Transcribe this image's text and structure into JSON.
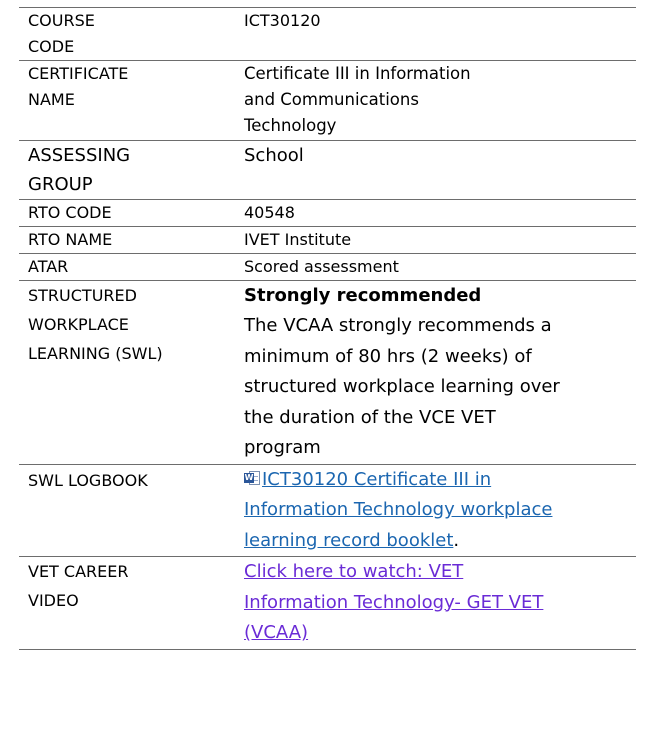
{
  "rows": [
    {
      "label": "COURSE\nCODE",
      "value": "ICT30120"
    },
    {
      "label": "CERTIFICATE\nNAME",
      "value": "Certificate III in Information\nand Communications\nTechnology"
    },
    {
      "label": "ASSESSING\nGROUP",
      "value": "School"
    },
    {
      "label": "RTO CODE",
      "value": "40548"
    },
    {
      "label": "RTO NAME",
      "value": "IVET Institute"
    },
    {
      "label": "ATAR",
      "value": "Scored assessment"
    },
    {
      "label": "STRUCTURED\nWORKPLACE\nLEARNING (SWL)",
      "value_heading": "Strongly recommended",
      "value": "The VCAA strongly recommends a\nminimum of 80 hrs (2 weeks) of\nstructured workplace learning over\nthe duration of the VCE VET\nprogram"
    },
    {
      "label": "SWL LOGBOOK",
      "link_text": "ICT30120 Certificate III in\nInformation Technology workplace\nlearning record booklet",
      "suffix": ".",
      "icon": "word-document-icon"
    },
    {
      "label": "VET CAREER\nVIDEO",
      "link_text": "Click here to watch: VET\nInformation Technology- GET VET\n(VCAA)"
    }
  ],
  "colors": {
    "doc_link": "#1b66b0",
    "video_link": "#6a2bd6",
    "border": "#6d6d6d"
  }
}
